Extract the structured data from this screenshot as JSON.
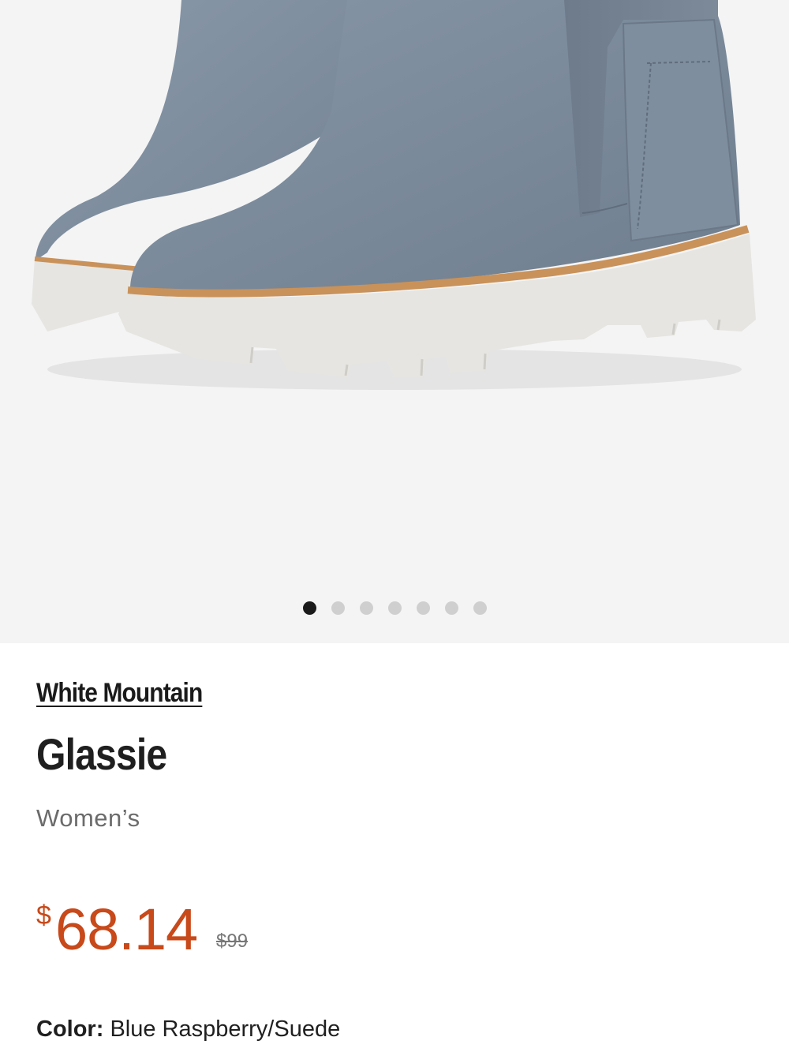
{
  "gallery": {
    "image_name": "gray suede chelsea boots with white lug soles",
    "dot_count": 7,
    "active_index": 0
  },
  "product": {
    "brand": "White Mountain",
    "name": "Glassie",
    "gender": "Women’s",
    "currency_symbol": "$",
    "price": "68.14",
    "original_price": "$99",
    "color_label": "Color:",
    "color_value": "Blue Raspberry/Suede"
  },
  "colors": {
    "price": "#c8491a",
    "suede": "#7b8a9b",
    "sole": "#e6e5e1",
    "welt": "#c9925a",
    "background": "#f4f4f4"
  }
}
